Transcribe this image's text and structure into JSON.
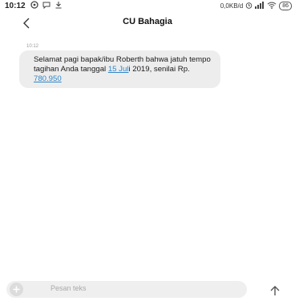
{
  "status_bar": {
    "time": "10:12",
    "left_icons": [
      "notification-icon",
      "message-icon",
      "download-icon"
    ],
    "speed": "0,0KB/d",
    "battery": "86"
  },
  "header": {
    "title": "CU Bahagia",
    "back_icon": "back-arrow-icon"
  },
  "conversation": {
    "timestamp": "10:12",
    "message": {
      "text_1": "Selamat pagi bapak/ibu Roberth bahwa jatuh tempo tagihan Anda tanggal ",
      "date_link": "15 Jul",
      "text_2": "i 2019, senilai Rp. ",
      "amount_link": "780.950"
    }
  },
  "composer": {
    "placeholder": "Pesan teks",
    "add_icon": "plus-icon",
    "send_icon": "up-arrow-icon"
  },
  "colors": {
    "link": "#2f86c9",
    "bubble": "#ededed",
    "composer": "#efefef"
  }
}
